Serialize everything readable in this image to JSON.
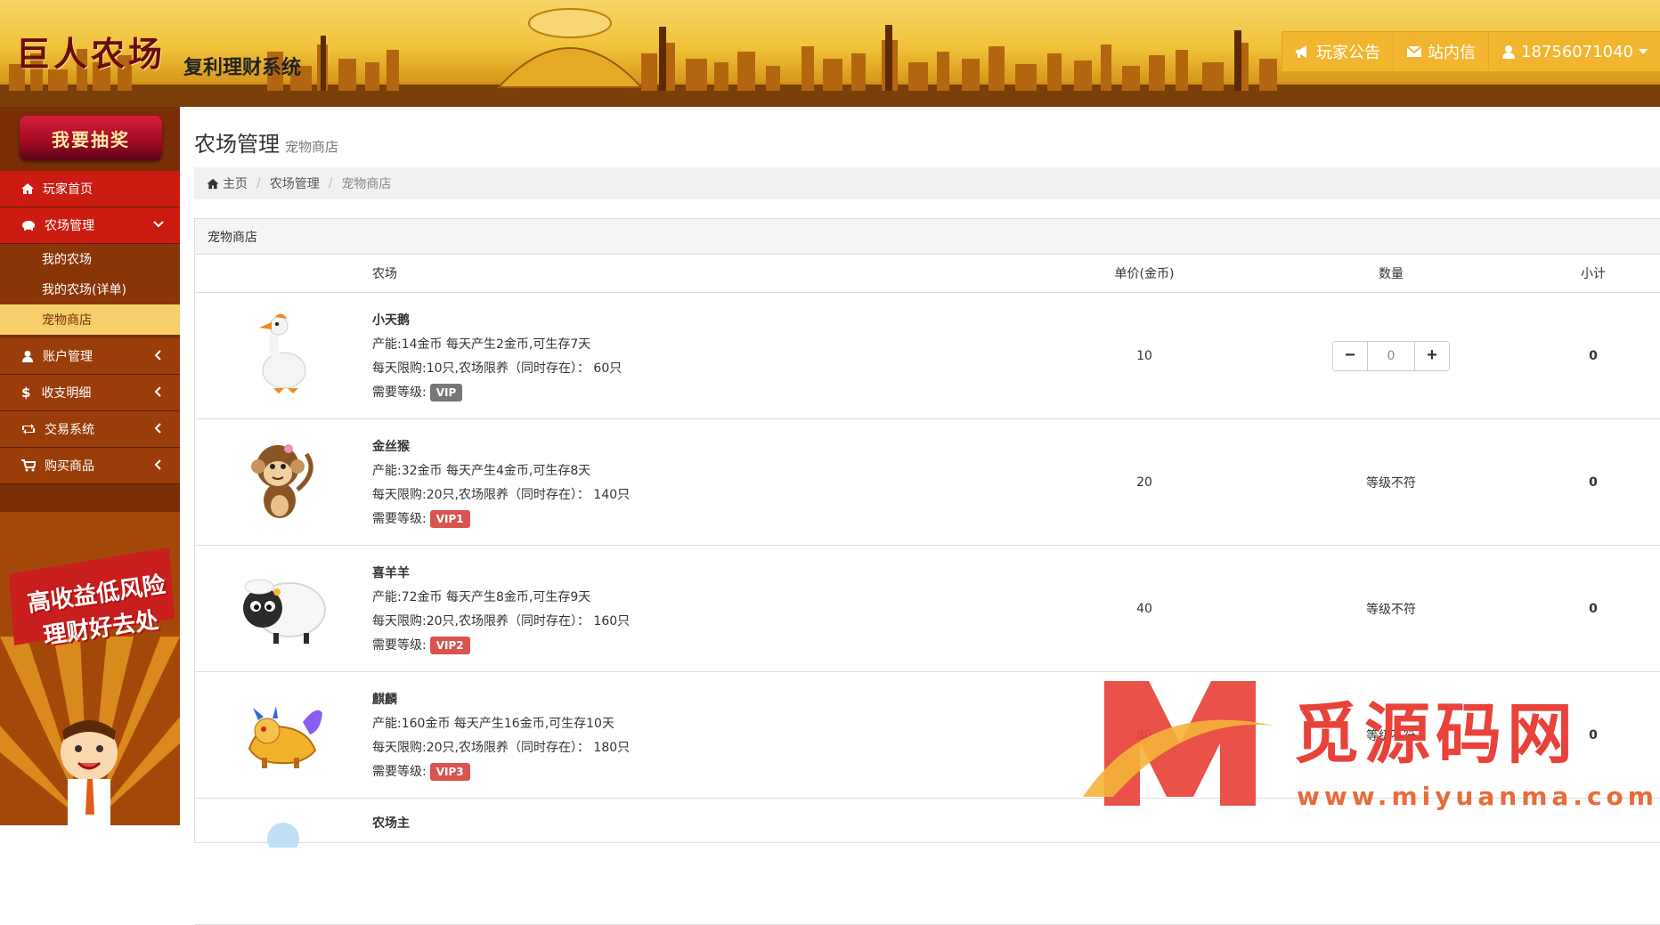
{
  "header": {
    "brand": "巨人农场",
    "brand_sub": "复利理财系统",
    "nav": [
      {
        "label": "玩家公告",
        "icon": "megaphone-icon"
      },
      {
        "label": "站内信",
        "icon": "envelope-icon"
      },
      {
        "label": "18756071040",
        "icon": "user-icon"
      }
    ]
  },
  "sidebar": {
    "lottery_button": "我要抽奖",
    "items": [
      {
        "label": "玩家首页",
        "icon": "home-icon"
      },
      {
        "label": "农场管理",
        "icon": "pig-icon"
      },
      {
        "label": "账户管理",
        "icon": "user-icon"
      },
      {
        "label": "收支明细",
        "icon": "dollar-icon"
      },
      {
        "label": "交易系统",
        "icon": "retweet-icon"
      },
      {
        "label": "购买商品",
        "icon": "cart-icon"
      }
    ],
    "sub_items": [
      "我的农场",
      "我的农场(详单)",
      "宠物商店"
    ],
    "promo": {
      "line1": "高收益低风险",
      "line2": "理财好去处"
    }
  },
  "page": {
    "title": "农场管理",
    "subtitle": "宠物商店",
    "breadcrumb": [
      "主页",
      "农场管理",
      "宠物商店"
    ]
  },
  "panel": {
    "heading": "宠物商店",
    "columns": [
      "农场",
      "单价(金币)",
      "数量",
      "小计"
    ],
    "rows": [
      {
        "name": "小天鹅",
        "capacity": "产能:14金币 每天产生2金币,可生存7天",
        "limit": "每天限购:10只,农场限养（同时存在）：  60只",
        "level_label": "需要等级:",
        "level": "VIP",
        "price": "10",
        "quantity": "0",
        "status": "",
        "subtotal": "0"
      },
      {
        "name": "金丝猴",
        "capacity": "产能:32金币 每天产生4金币,可生存8天",
        "limit": "每天限购:20只,农场限养（同时存在）：  140只",
        "level_label": "需要等级:",
        "level": "VIP1",
        "price": "20",
        "quantity": "",
        "status": "等级不符",
        "subtotal": "0"
      },
      {
        "name": "喜羊羊",
        "capacity": "产能:72金币 每天产生8金币,可生存9天",
        "limit": "每天限购:20只,农场限养（同时存在）：  160只",
        "level_label": "需要等级:",
        "level": "VIP2",
        "price": "40",
        "quantity": "",
        "status": "等级不符",
        "subtotal": "0"
      },
      {
        "name": "麒麟",
        "capacity": "产能:160金币 每天产生16金币,可生存10天",
        "limit": "每天限购:20只,农场限养（同时存在）：  180只",
        "level_label": "需要等级:",
        "level": "VIP3",
        "price": "80",
        "quantity": "",
        "status": "等级不符",
        "subtotal": "0"
      },
      {
        "name": "农场主",
        "capacity": "",
        "limit": "",
        "level_label": "",
        "level": "",
        "price": "",
        "quantity": "",
        "status": "",
        "subtotal": ""
      }
    ]
  },
  "colors": {
    "vip": "#777777",
    "vip_locked": "#d9534f",
    "sidebar": "#7b2d06",
    "active": "#f5cf6a"
  },
  "watermark": {
    "text": "觅源码网",
    "url": "www.miyuanma.com"
  }
}
